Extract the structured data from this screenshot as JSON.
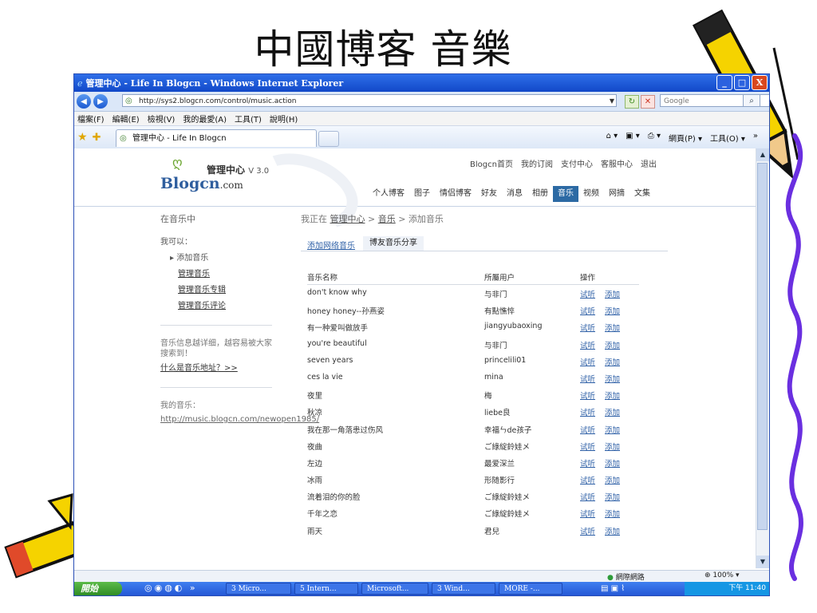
{
  "slide": {
    "title": "中國博客 音樂"
  },
  "window": {
    "title": "管理中心 - Life In Blogcn - Windows Internet Explorer",
    "controls": {
      "minimize": "_",
      "maximize": "□",
      "close": "X"
    }
  },
  "address": {
    "back": "◀",
    "forward": "▶",
    "url": "http://sys2.blogcn.com/control/music.action",
    "refresh": "↻",
    "stop": "✕",
    "search_placeholder": "Google",
    "search_btn": "⌕"
  },
  "menubar": [
    "檔案(F)",
    "編輯(E)",
    "檢視(V)",
    "我的最愛(A)",
    "工具(T)",
    "說明(H)"
  ],
  "favbar": {
    "tab_label": "管理中心 - Life In Blogcn",
    "commands": [
      "⌂ ▾",
      "▣ ▾",
      "⎙ ▾",
      "網頁(P) ▾",
      "工具(O) ▾",
      "»"
    ]
  },
  "site": {
    "logo_sub": "管理中心",
    "logo_version": "V 3.0",
    "logo_main": "Blogcn",
    "logo_dotcom": ".com",
    "top_links": [
      "Blogcn首页",
      "我的订阅",
      "支付中心",
      "客服中心",
      "退出"
    ],
    "nav_links": [
      "个人博客",
      "图子",
      "情侣博客",
      "好友",
      "消息",
      "相册",
      "音乐",
      "视频",
      "网摘",
      "文集"
    ],
    "nav_active": "音乐"
  },
  "sidebar": {
    "title": "在音乐中",
    "can_do": "我可以：",
    "current": "▸ 添加音乐",
    "links": [
      "管理音乐",
      "管理音乐专辑",
      "管理音乐评论"
    ],
    "note": "音乐信息越详细，越容易被大家搜索到！",
    "note_link": "什么是音乐地址？>>",
    "my_music_label": "我的音乐：",
    "my_music_url": "http://music.blogcn.com/newopen1985/"
  },
  "breadcrumb": {
    "prefix": "我正在",
    "crumb1": "管理中心",
    "sep": ">",
    "crumb2": "音乐",
    "current": "添加音乐"
  },
  "subtabs": {
    "tab1": "添加网络音乐",
    "tab2": "博友音乐分享"
  },
  "table": {
    "headers": {
      "name": "音乐名称",
      "user": "所屬用户",
      "action": "操作"
    },
    "action_listen": "试听",
    "action_add": "添加",
    "rows": [
      {
        "name": "don't know why",
        "user": "与非门"
      },
      {
        "name": "honey honey--孙燕姿",
        "user": "有點憔悴"
      },
      {
        "name": "有一种爱叫做放手",
        "user": "jiangyubaoxing"
      },
      {
        "name": "you're beautiful",
        "user": "与非门"
      },
      {
        "name": "seven years",
        "user": "princelili01"
      },
      {
        "name": "ces la vie",
        "user": "mina"
      },
      {
        "name": "夜里",
        "user": "梅"
      },
      {
        "name": "秋凉",
        "user": "liebe良"
      },
      {
        "name": "我在那一角落患过伤风",
        "user": "幸福ㄣde孩子"
      },
      {
        "name": "夜曲",
        "user": "ご綠綻鈴娃メ"
      },
      {
        "name": "左边",
        "user": "最爱深兰"
      },
      {
        "name": "冰雨",
        "user": "形随影行"
      },
      {
        "name": "流着泪的你的脸",
        "user": "ご綠綻鈴娃メ"
      },
      {
        "name": "千年之恋",
        "user": "ご綠綻鈴娃メ"
      },
      {
        "name": "雨天",
        "user": "君兒"
      }
    ]
  },
  "status": {
    "net": "網際網路",
    "zoom": "100%"
  },
  "taskbar": {
    "start": "開始",
    "buttons": [
      "3 Micro...",
      "5 Intern...",
      "Microsoft...",
      "3 Wind...",
      "MORE -..."
    ],
    "clock": "下午 11:40"
  },
  "colors": {
    "accent": "#2c6aa4",
    "link": "#2d5fa6",
    "titlebar": "#1148c8",
    "pencil_yellow": "#f5d300",
    "scribble": "#6a2fe0"
  }
}
